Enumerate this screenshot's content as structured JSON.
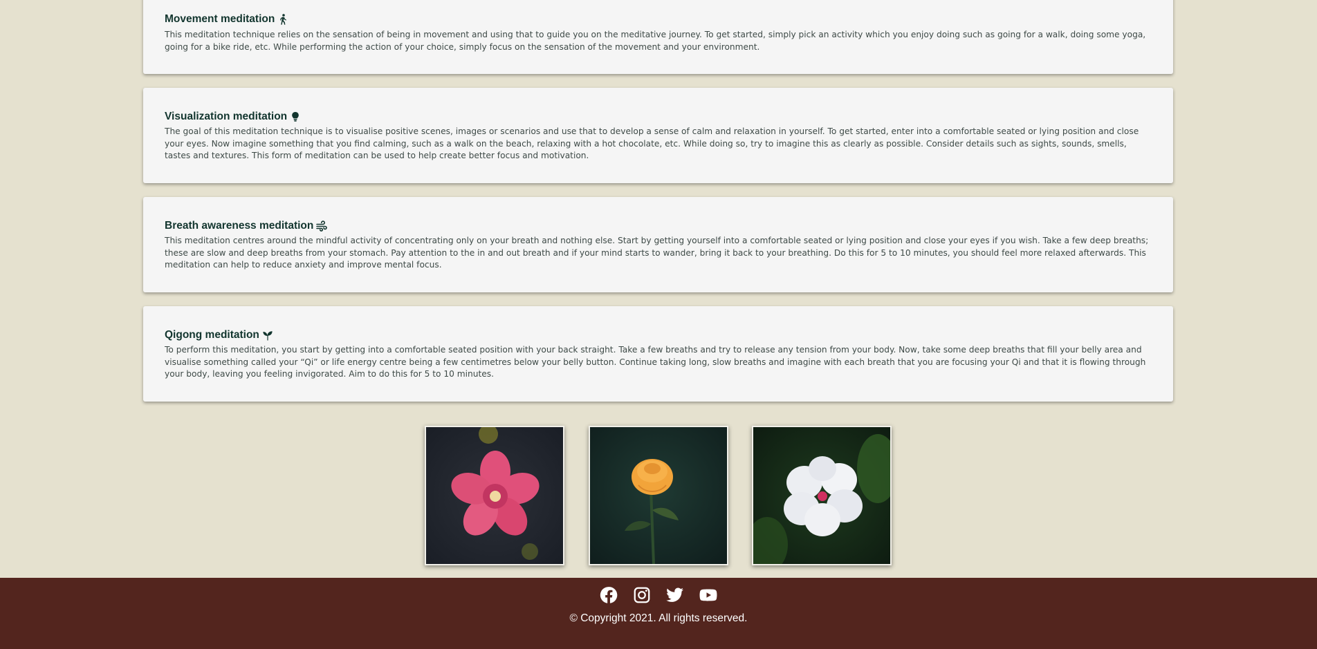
{
  "colors": {
    "page_background": "#e5e1cf",
    "card_background": "#f5f5f5",
    "heading": "#12352e",
    "body_text": "#3e4a47",
    "footer_background": "#53251e",
    "footer_text": "#ffffff"
  },
  "meditations": [
    {
      "title": "Movement meditation",
      "icon": "walking-person-icon",
      "text": "This meditation technique relies on the sensation of being in movement and using that to guide you on the meditative journey. To get started, simply pick an activity which you enjoy doing such as going for a walk, doing some yoga, going for a bike ride, etc. While performing the action of your choice, simply focus on the sensation of the movement and your environment."
    },
    {
      "title": "Visualization meditation",
      "icon": "lightbulb-icon",
      "text": "The goal of this meditation technique is to visualise positive scenes, images or scenarios and use that to develop a sense of calm and relaxation in yourself. To get started, enter into a comfortable seated or lying position and close your eyes. Now imagine something that you find calming, such as a walk on the beach, relaxing with a hot chocolate, etc. While doing so, try to imagine this as clearly as possible. Consider details such as sights, sounds, smells, tastes and textures. This form of meditation can be used to help create better focus and motivation."
    },
    {
      "title": "Breath awareness meditation",
      "icon": "wind-icon",
      "text": "This meditation centres around the mindful activity of concentrating only on your breath and nothing else. Start by getting yourself into a comfortable seated or lying position and close your eyes if you wish. Take a few deep breaths; these are slow and deep breaths from your stomach. Pay attention to the in and out breath and if your mind starts to wander, bring it back to your breathing. Do this for 5 to 10 minutes, you should feel more relaxed afterwards. This meditation can help to reduce anxiety and improve mental focus."
    },
    {
      "title": "Qigong meditation",
      "icon": "seedling-icon",
      "text": "To perform this meditation, you start by getting into a comfortable seated position with your back straight. Take a few breaths and try to release any tension from your body. Now, take some deep breaths that fill your belly area and visualise something called your “Qi” or life energy centre being a few centimetres below your belly button. Continue taking long, slow breaths and imagine with each breath that you are focusing your Qi and that it is flowing through your body, leaving you feeling invigorated. Aim to do this for 5 to 10 minutes."
    }
  ],
  "gallery": [
    {
      "name": "pink-flower-photo"
    },
    {
      "name": "orange-rose-photo"
    },
    {
      "name": "white-flower-photo"
    }
  ],
  "footer": {
    "social_icons": [
      "facebook-icon",
      "instagram-icon",
      "twitter-icon",
      "youtube-icon"
    ],
    "copyright": "© Copyright 2021. All rights reserved."
  }
}
